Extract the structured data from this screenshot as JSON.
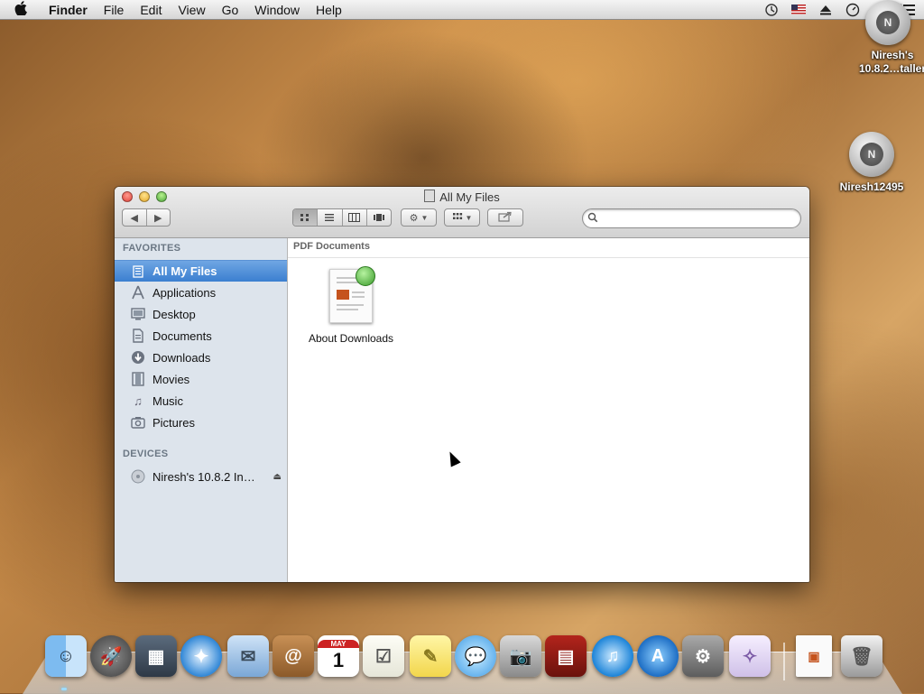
{
  "menubar": {
    "app": "Finder",
    "items": [
      "File",
      "Edit",
      "View",
      "Go",
      "Window",
      "Help"
    ],
    "status_icons": [
      "time-machine-icon",
      "us-flag-icon",
      "eject-icon",
      "clock-icon",
      "spotlight-icon",
      "notification-list-icon"
    ]
  },
  "desktop": {
    "icons": [
      {
        "label": "Niresh's 10.8.2…taller"
      },
      {
        "label": "Niresh12495"
      }
    ]
  },
  "window": {
    "title": "All My Files",
    "search": {
      "placeholder": "",
      "value": ""
    },
    "sidebar": {
      "favorites_header": "FAVORITES",
      "favorites": [
        {
          "label": "All My Files",
          "icon": "all-my-files-icon",
          "selected": true
        },
        {
          "label": "Applications",
          "icon": "applications-icon"
        },
        {
          "label": "Desktop",
          "icon": "desktop-icon"
        },
        {
          "label": "Documents",
          "icon": "documents-icon"
        },
        {
          "label": "Downloads",
          "icon": "downloads-icon"
        },
        {
          "label": "Movies",
          "icon": "movies-icon"
        },
        {
          "label": "Music",
          "icon": "music-icon"
        },
        {
          "label": "Pictures",
          "icon": "pictures-icon"
        }
      ],
      "devices_header": "DEVICES",
      "devices": [
        {
          "label": "Niresh's 10.8.2 In…",
          "icon": "disk-icon"
        }
      ]
    },
    "content": {
      "group_header": "PDF Documents",
      "files": [
        {
          "label": "About Downloads",
          "icon": "pdf-icon"
        }
      ]
    }
  },
  "dock": {
    "apps": [
      "finder",
      "launchpad",
      "photo-browser",
      "safari",
      "mail",
      "contacts",
      "calendar",
      "reminders",
      "notes",
      "messages",
      "facetime",
      "photo-booth",
      "itunes",
      "app-store",
      "system-preferences",
      "installer"
    ],
    "calendar_month": "MAY",
    "calendar_day": "1"
  },
  "colors": {
    "selection": "#3b7fd0",
    "sidebar_bg": "#dde4ec"
  }
}
